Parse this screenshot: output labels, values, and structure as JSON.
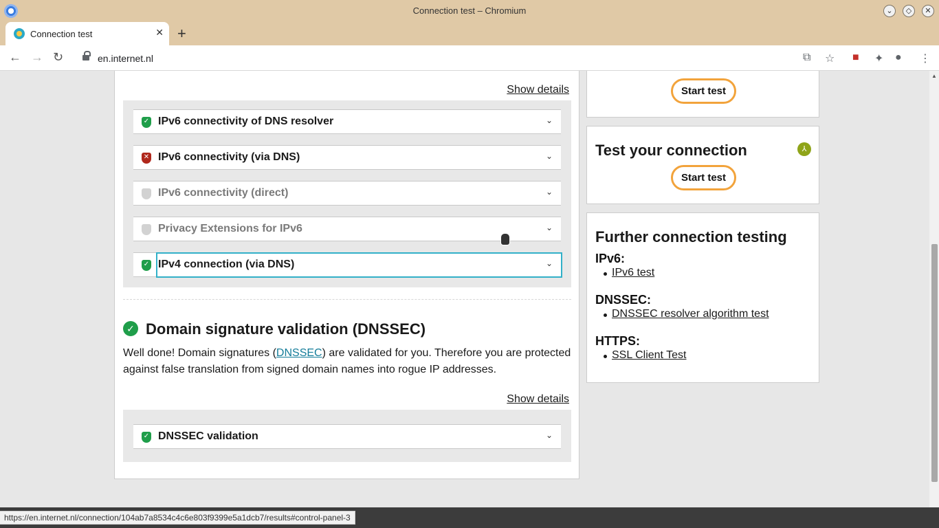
{
  "window": {
    "title": "Connection test – Chromium"
  },
  "tab": {
    "title": "Connection test",
    "close": "✕",
    "new_tab": "+"
  },
  "toolbar": {
    "url": "en.internet.nl"
  },
  "main": {
    "ipv6_section": {
      "show_details": "Show details",
      "tests": [
        {
          "title": "IPv6 connectivity of DNS resolver",
          "status": "passed"
        },
        {
          "title": "IPv6 connectivity (via DNS)",
          "status": "failed"
        },
        {
          "title": "IPv6 connectivity (direct)",
          "status": "not-tested"
        },
        {
          "title": "Privacy Extensions for IPv6",
          "status": "not-tested"
        },
        {
          "title": "IPv4 connection (via DNS)",
          "status": "passed"
        }
      ]
    },
    "dnssec_section": {
      "heading": "Domain signature validation (DNSSEC)",
      "text_before": "Well done! Domain signatures (",
      "link": "DNSSEC",
      "text_after": ") are validated for you. Therefore you are protected against false translation from signed domain names into rogue IP addresses.",
      "show_details": "Show details",
      "tests": [
        {
          "title": "DNSSEC validation",
          "status": "passed"
        }
      ]
    }
  },
  "sidebar": {
    "top_card": {
      "button": "Start test"
    },
    "connection_card": {
      "title": "Test your connection",
      "button": "Start test"
    },
    "further": {
      "title": "Further connection testing",
      "groups": [
        {
          "label": "IPv6:",
          "link": "IPv6 test"
        },
        {
          "label": "DNSSEC:",
          "link": "DNSSEC resolver algorithm test"
        },
        {
          "label": "HTTPS:",
          "link": "SSL Client Test"
        }
      ]
    }
  },
  "status_bar": {
    "url": "https://en.internet.nl/connection/104ab7a8534c4c6e803f9399e5a1dcb7/results#control-panel-3"
  }
}
